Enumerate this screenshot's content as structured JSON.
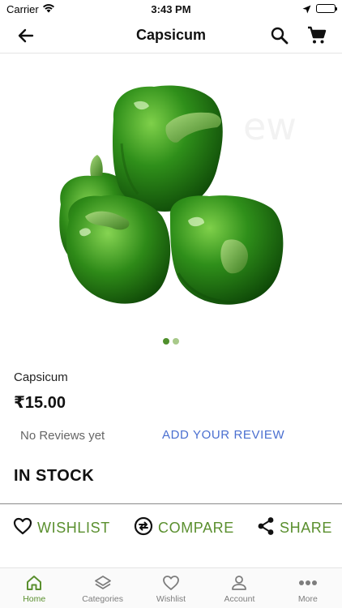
{
  "status_bar": {
    "carrier": "Carrier",
    "time": "3:43 PM"
  },
  "app_bar": {
    "title": "Capsicum",
    "icons": [
      "back-arrow-icon",
      "search-icon",
      "cart-icon"
    ]
  },
  "product": {
    "image_subject": "green-bell-peppers",
    "carousel": {
      "count": 2,
      "active_index": 0
    },
    "name": "Capsicum",
    "price": "₹15.00",
    "reviews_text": "No Reviews yet",
    "add_review_label": "ADD YOUR REVIEW",
    "stock_status": "IN STOCK"
  },
  "actions": [
    {
      "label": "WISHLIST",
      "icon": "heart-icon"
    },
    {
      "label": "COMPARE",
      "icon": "compare-icon"
    },
    {
      "label": "SHARE",
      "icon": "share-icon"
    }
  ],
  "bottom_nav": {
    "active": "Home",
    "items": [
      {
        "label": "Home",
        "icon": "home-icon"
      },
      {
        "label": "Categories",
        "icon": "layers-icon"
      },
      {
        "label": "Wishlist",
        "icon": "heart-outline-icon"
      },
      {
        "label": "Account",
        "icon": "account-icon"
      },
      {
        "label": "More",
        "icon": "more-dots-icon"
      }
    ]
  },
  "colors": {
    "accent_green": "#5a8f2e",
    "review_link_blue": "#4a6fd0",
    "dot_active": "#4f8f2c",
    "dot_inactive": "#a8c98a"
  }
}
